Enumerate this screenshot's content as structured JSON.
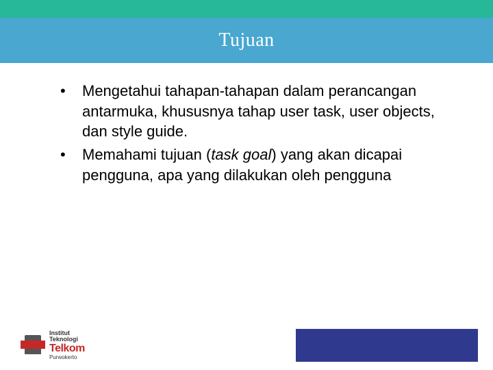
{
  "header": {
    "title": "Tujuan"
  },
  "bullets": [
    {
      "text": "Mengetahui tahapan-tahapan dalam perancangan antarmuka, khususnya tahap user task, user objects, dan style guide."
    },
    {
      "text_pre": "Memahami tujuan (",
      "text_italic": "task goal",
      "text_post": ") yang akan dicapai pengguna, apa yang dilakukan oleh pengguna"
    }
  ],
  "logo": {
    "line1": "Institut",
    "line2": "Teknologi",
    "brand": "Telkom",
    "sub": "Purwokerto"
  },
  "colors": {
    "green": "#27b89a",
    "blue_header": "#49a7d0",
    "footer_blue": "#2f3a8f",
    "brand_red": "#c62828"
  }
}
